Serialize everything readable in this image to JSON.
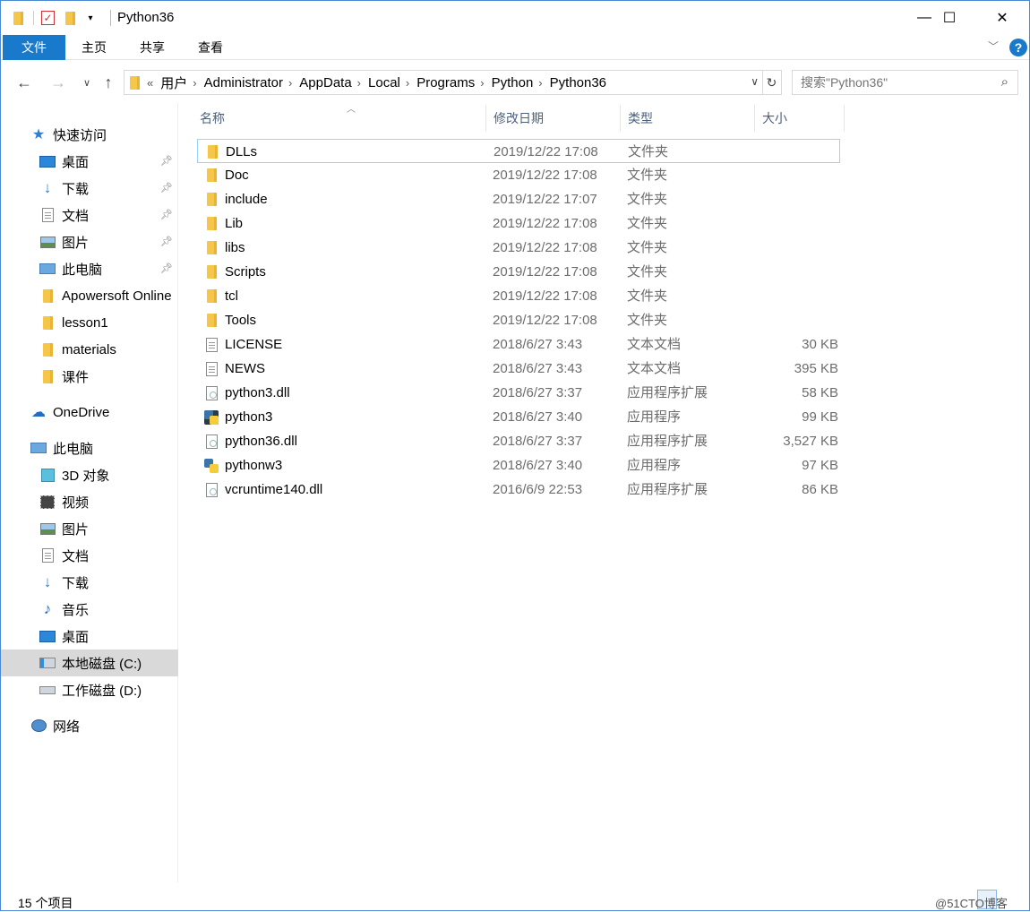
{
  "window": {
    "title": "Python36",
    "minimize": "—",
    "maximize": "☐",
    "close": "✕"
  },
  "ribbon": {
    "tabs": [
      "文件",
      "主页",
      "共享",
      "查看"
    ]
  },
  "address": {
    "overflow": "«",
    "crumbs": [
      "用户",
      "Administrator",
      "AppData",
      "Local",
      "Programs",
      "Python",
      "Python36"
    ]
  },
  "search": {
    "placeholder": "搜索\"Python36\""
  },
  "nav": {
    "quick_access": "快速访问",
    "quick_items": [
      {
        "label": "桌面",
        "icon": "desktop-icon",
        "pinned": true
      },
      {
        "label": "下载",
        "icon": "download-icon",
        "pinned": true
      },
      {
        "label": "文档",
        "icon": "document-icon",
        "pinned": true
      },
      {
        "label": "图片",
        "icon": "picture-icon",
        "pinned": true
      },
      {
        "label": "此电脑",
        "icon": "computer-icon",
        "pinned": true
      },
      {
        "label": "Apowersoft Online",
        "icon": "folder-icon",
        "pinned": false
      },
      {
        "label": "lesson1",
        "icon": "folder-icon",
        "pinned": false
      },
      {
        "label": "materials",
        "icon": "folder-icon",
        "pinned": false
      },
      {
        "label": "课件",
        "icon": "folder-icon",
        "pinned": false
      }
    ],
    "onedrive": "OneDrive",
    "this_pc": "此电脑",
    "pc_items": [
      {
        "label": "3D 对象",
        "icon": "3d-objects-icon"
      },
      {
        "label": "视频",
        "icon": "video-icon"
      },
      {
        "label": "图片",
        "icon": "picture-icon"
      },
      {
        "label": "文档",
        "icon": "document-icon"
      },
      {
        "label": "下载",
        "icon": "download-icon"
      },
      {
        "label": "音乐",
        "icon": "music-icon"
      },
      {
        "label": "桌面",
        "icon": "desktop-icon"
      },
      {
        "label": "本地磁盘 (C:)",
        "icon": "drive-c-icon"
      },
      {
        "label": "工作磁盘 (D:)",
        "icon": "drive-d-icon"
      }
    ],
    "network": "网络"
  },
  "columns": {
    "name": "名称",
    "date": "修改日期",
    "type": "类型",
    "size": "大小"
  },
  "files": [
    {
      "name": "DLLs",
      "date": "2019/12/22 17:08",
      "type": "文件夹",
      "size": "",
      "icon": "folder"
    },
    {
      "name": "Doc",
      "date": "2019/12/22 17:08",
      "type": "文件夹",
      "size": "",
      "icon": "folder"
    },
    {
      "name": "include",
      "date": "2019/12/22 17:07",
      "type": "文件夹",
      "size": "",
      "icon": "folder"
    },
    {
      "name": "Lib",
      "date": "2019/12/22 17:08",
      "type": "文件夹",
      "size": "",
      "icon": "folder"
    },
    {
      "name": "libs",
      "date": "2019/12/22 17:08",
      "type": "文件夹",
      "size": "",
      "icon": "folder"
    },
    {
      "name": "Scripts",
      "date": "2019/12/22 17:08",
      "type": "文件夹",
      "size": "",
      "icon": "folder"
    },
    {
      "name": "tcl",
      "date": "2019/12/22 17:08",
      "type": "文件夹",
      "size": "",
      "icon": "folder"
    },
    {
      "name": "Tools",
      "date": "2019/12/22 17:08",
      "type": "文件夹",
      "size": "",
      "icon": "folder"
    },
    {
      "name": "LICENSE",
      "date": "2018/6/27 3:43",
      "type": "文本文档",
      "size": "30 KB",
      "icon": "doc"
    },
    {
      "name": "NEWS",
      "date": "2018/6/27 3:43",
      "type": "文本文档",
      "size": "395 KB",
      "icon": "doc"
    },
    {
      "name": "python3.dll",
      "date": "2018/6/27 3:37",
      "type": "应用程序扩展",
      "size": "58 KB",
      "icon": "dll"
    },
    {
      "name": "python3",
      "date": "2018/6/27 3:40",
      "type": "应用程序",
      "size": "99 KB",
      "icon": "python-dark"
    },
    {
      "name": "python36.dll",
      "date": "2018/6/27 3:37",
      "type": "应用程序扩展",
      "size": "3,527 KB",
      "icon": "dll"
    },
    {
      "name": "pythonw3",
      "date": "2018/6/27 3:40",
      "type": "应用程序",
      "size": "97 KB",
      "icon": "python"
    },
    {
      "name": "vcruntime140.dll",
      "date": "2016/6/9 22:53",
      "type": "应用程序扩展",
      "size": "86 KB",
      "icon": "dll"
    }
  ],
  "status": {
    "count": "15 个项目",
    "watermark": "@51CTO博客"
  },
  "colors": {
    "accent": "#1979ca",
    "folder": "#f6c64a"
  }
}
